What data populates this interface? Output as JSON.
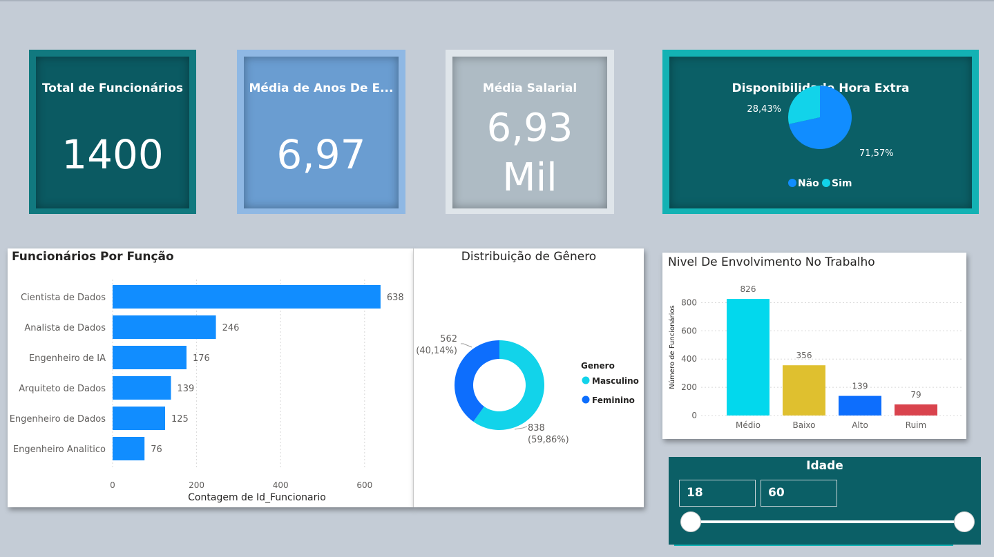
{
  "kpis": {
    "total_funcionarios": {
      "title": "Total de Funcionários",
      "value": "1400"
    },
    "media_anos": {
      "title": "Média de Anos De E...",
      "value": "6,97"
    },
    "media_salarial": {
      "title": "Média Salarial",
      "value_line1": "6,93",
      "value_line2": "Mil"
    }
  },
  "hora_extra": {
    "title": "Disponibilidade Hora Extra",
    "colors": {
      "Não": "#118dff",
      "Sim": "#12d3ea"
    }
  },
  "funcionarios_por_funcao": {
    "title": "Funcionários Por Função"
  },
  "distribuicao_genero": {
    "title": "Distribuição de Gênero",
    "legend_title": "Genero"
  },
  "envolvimento": {
    "title": "Nivel De Envolvimento No Trabalho"
  },
  "idade": {
    "title": "Idade",
    "min": "18",
    "max": "60",
    "range": [
      18,
      60
    ]
  },
  "chart_data": [
    {
      "type": "pie",
      "title": "Disponibilidade Hora Extra",
      "categories": [
        "Não",
        "Sim"
      ],
      "values": [
        71.57,
        28.43
      ],
      "labels": [
        "71,57%",
        "28,43%"
      ],
      "legend": "bottom"
    },
    {
      "type": "bar",
      "orientation": "horizontal",
      "title": "Funcionários Por Função",
      "categories": [
        "Cientista de Dados",
        "Analista de Dados",
        "Engenheiro de IA",
        "Arquiteto de Dados",
        "Engenheiro de Dados",
        "Engenheiro Analitico"
      ],
      "values": [
        638,
        246,
        176,
        139,
        125,
        76
      ],
      "xlabel": "Contagem de Id_Funcionario",
      "ylabel": "",
      "xlim": [
        0,
        700
      ],
      "ticks": [
        0,
        200,
        400,
        600
      ],
      "color": "#118dff",
      "grid": true
    },
    {
      "type": "pie",
      "variant": "donut",
      "title": "Distribuição de Gênero",
      "categories": [
        "Masculino",
        "Feminino"
      ],
      "values": [
        838,
        562
      ],
      "labels": [
        [
          "838",
          "(59,86%)"
        ],
        [
          "562",
          "(40,14%)"
        ]
      ],
      "colors": [
        "#12d3ea",
        "#0d6efd"
      ],
      "legend_title": "Genero",
      "legend": "right"
    },
    {
      "type": "bar",
      "title": "Nivel De Envolvimento No Trabalho",
      "categories": [
        "Médio",
        "Baixo",
        "Alto",
        "Ruim"
      ],
      "values": [
        826,
        356,
        139,
        79
      ],
      "colors": [
        "#02d8ed",
        "#dfc02f",
        "#0d6efd",
        "#d9434d"
      ],
      "xlabel": "",
      "ylabel": "Número de Funcionários",
      "ylim": [
        0,
        900
      ],
      "ticks": [
        0,
        200,
        400,
        600,
        800
      ],
      "grid": true
    }
  ]
}
